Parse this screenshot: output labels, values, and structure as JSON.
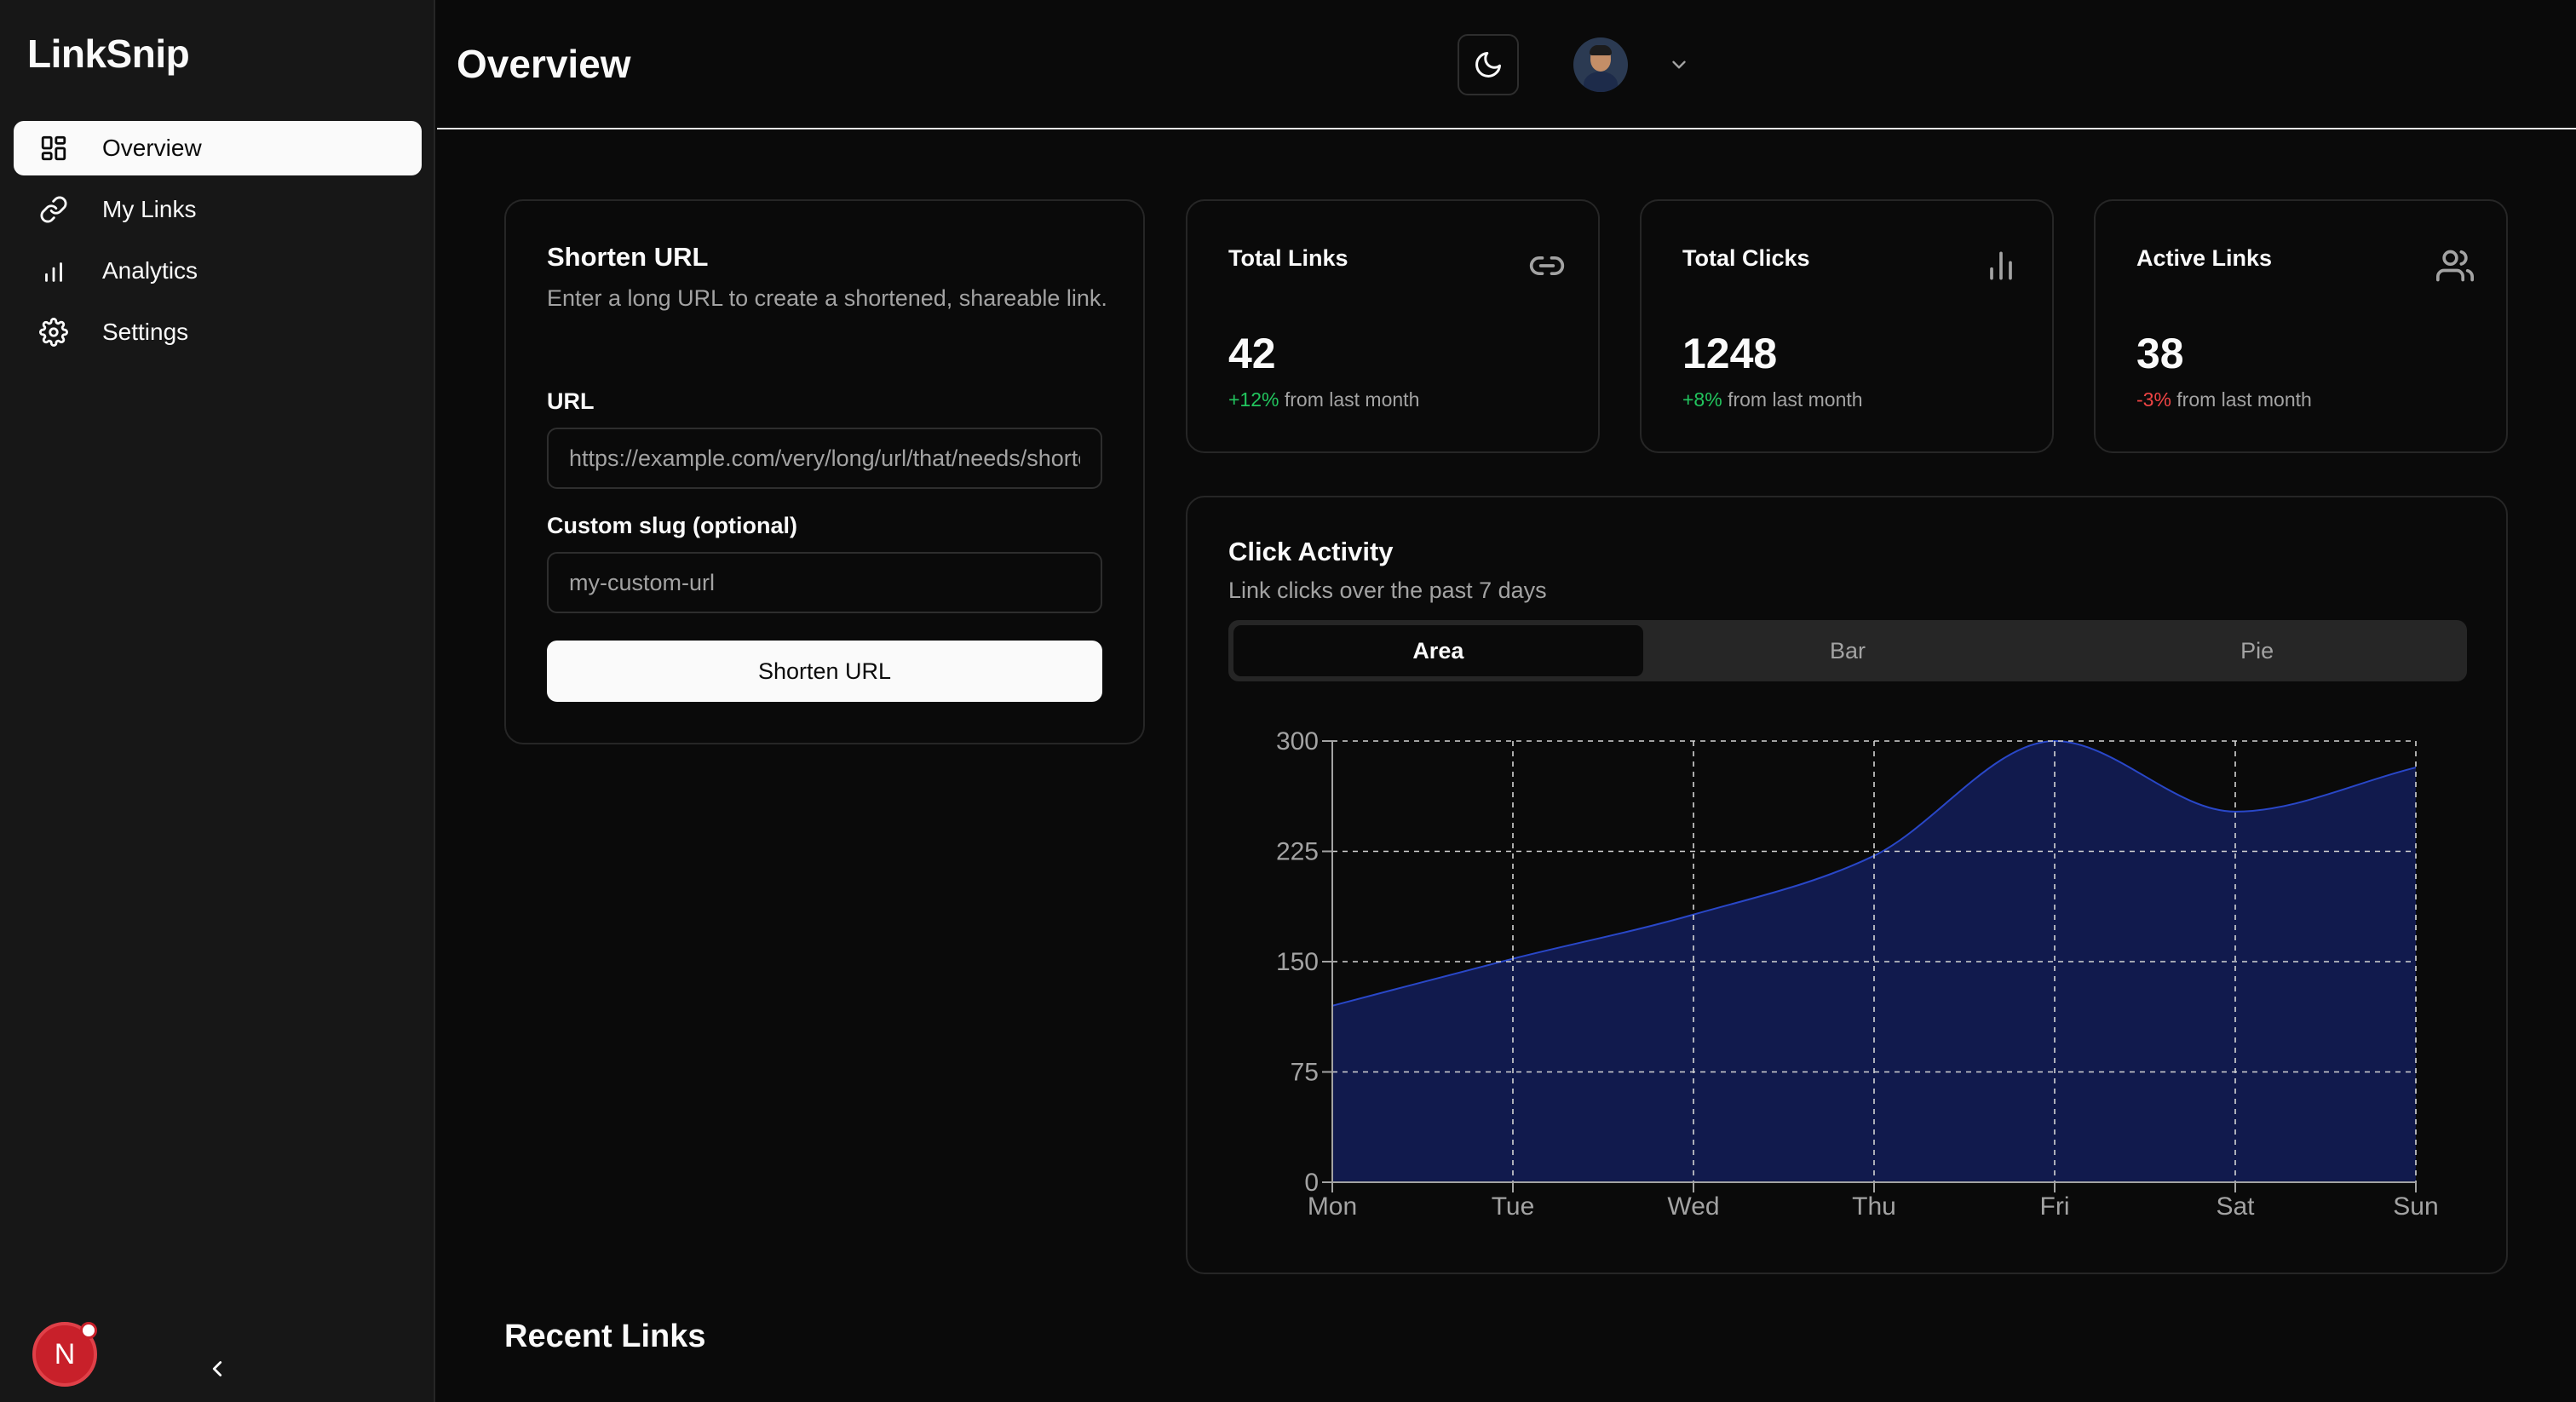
{
  "app": {
    "name": "LinkSnip"
  },
  "sidebar": {
    "items": [
      {
        "label": "Overview",
        "icon": "layout-grid-icon",
        "active": true
      },
      {
        "label": "My Links",
        "icon": "link-icon",
        "active": false
      },
      {
        "label": "Analytics",
        "icon": "bar-chart-icon",
        "active": false
      },
      {
        "label": "Settings",
        "icon": "gear-icon",
        "active": false
      }
    ],
    "avatar_initial": "N"
  },
  "header": {
    "title": "Overview"
  },
  "shorten": {
    "title": "Shorten URL",
    "description": "Enter a long URL to create a shortened, shareable link.",
    "url_label": "URL",
    "url_placeholder": "https://example.com/very/long/url/that/needs/shortening",
    "slug_label": "Custom slug (optional)",
    "slug_placeholder": "my-custom-url",
    "button_label": "Shorten URL"
  },
  "stats": [
    {
      "label": "Total Links",
      "value": "42",
      "change": "+12%",
      "change_suffix": " from last month",
      "trend": "positive",
      "icon": "link-icon"
    },
    {
      "label": "Total Clicks",
      "value": "1248",
      "change": "+8%",
      "change_suffix": " from last month",
      "trend": "positive",
      "icon": "bar-chart-icon"
    },
    {
      "label": "Active Links",
      "value": "38",
      "change": "-3%",
      "change_suffix": " from last month",
      "trend": "negative",
      "icon": "users-icon"
    }
  ],
  "activity": {
    "title": "Click Activity",
    "description": "Link clicks over the past 7 days",
    "tabs": [
      {
        "label": "Area",
        "active": true
      },
      {
        "label": "Bar",
        "active": false
      },
      {
        "label": "Pie",
        "active": false
      }
    ]
  },
  "chart_data": {
    "type": "area",
    "categories": [
      "Mon",
      "Tue",
      "Wed",
      "Thu",
      "Fri",
      "Sat",
      "Sun"
    ],
    "values": [
      120,
      152,
      182,
      222,
      300,
      252,
      282
    ],
    "ylim": [
      0,
      300
    ],
    "yticks": [
      0,
      75,
      150,
      225,
      300
    ],
    "grid": true,
    "colors": {
      "fill": "#111a4d",
      "stroke": "#2947c8",
      "grid": "#d4d4d4",
      "axis": "#a3a3a3"
    }
  },
  "recent": {
    "title": "Recent Links"
  }
}
